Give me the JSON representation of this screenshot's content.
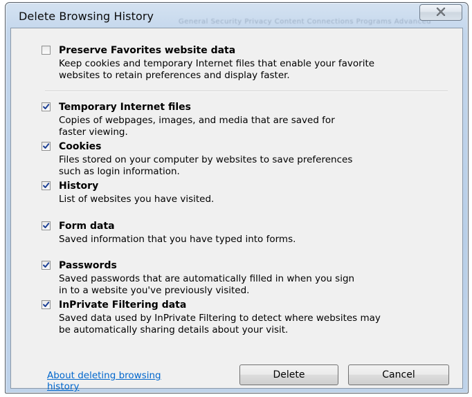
{
  "window": {
    "title": "Delete Browsing History",
    "background_tabs_text": "General  Security  Privacy  Content  Connections  Programs  Advanced",
    "close_icon": "close-x-icon"
  },
  "options": [
    {
      "title": "Preserve Favorites website data",
      "checked": false,
      "desc_lines": [
        "Keep cookies and temporary Internet files that enable your favorite",
        "websites to retain preferences and display faster."
      ]
    },
    {
      "title": "Temporary Internet files",
      "checked": true,
      "desc_lines": [
        "Copies of webpages, images, and media that are saved for",
        "faster viewing."
      ]
    },
    {
      "title": "Cookies",
      "checked": true,
      "desc_lines": [
        "Files stored on your computer by websites to save preferences",
        "such as login information."
      ]
    },
    {
      "title": "History",
      "checked": true,
      "desc_lines": [
        "List of websites you have visited."
      ]
    },
    {
      "title": "Form data",
      "checked": true,
      "desc_lines": [
        "Saved information that you have typed into forms."
      ]
    },
    {
      "title": "Passwords",
      "checked": true,
      "desc_lines": [
        "Saved passwords that are automatically filled in when you sign",
        "in to a website you've previously visited."
      ]
    },
    {
      "title": "InPrivate Filtering data",
      "checked": true,
      "desc_lines": [
        "Saved data used by InPrivate Filtering to detect where websites may",
        "be automatically sharing details about your visit."
      ]
    }
  ],
  "footer": {
    "help_link_lines": [
      "About deleting browsing",
      "history"
    ],
    "delete_label": "Delete",
    "cancel_label": "Cancel"
  },
  "colors": {
    "link": "#0066cc",
    "check": "#1c3f94",
    "frame": "#b9cfe8",
    "client": "#f0f0f0"
  }
}
